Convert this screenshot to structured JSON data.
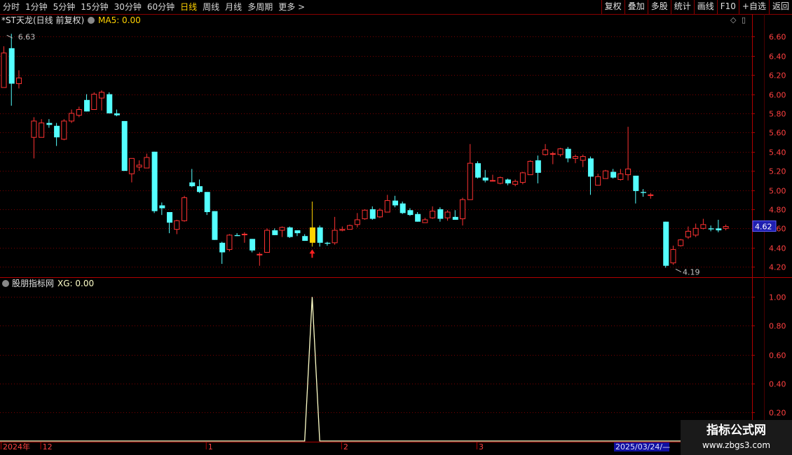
{
  "toolbar": {
    "periods": [
      {
        "label": "分时",
        "active": false
      },
      {
        "label": "1分钟",
        "active": false
      },
      {
        "label": "5分钟",
        "active": false
      },
      {
        "label": "15分钟",
        "active": false
      },
      {
        "label": "30分钟",
        "active": false
      },
      {
        "label": "60分钟",
        "active": false
      },
      {
        "label": "日线",
        "active": true
      },
      {
        "label": "周线",
        "active": false
      },
      {
        "label": "月线",
        "active": false
      },
      {
        "label": "多周期",
        "active": false
      },
      {
        "label": "更多 >",
        "active": false
      }
    ],
    "buttons": [
      "复权",
      "叠加",
      "多股",
      "统计",
      "画线",
      "F10",
      "+自选",
      "返回"
    ]
  },
  "chart_data": [
    {
      "type": "candlestick",
      "title": "*ST天龙(日线 前复权)",
      "indicator_label": "MA5: 0.00",
      "ylim": [
        4.12,
        6.72
      ],
      "y_ticks": [
        4.2,
        4.4,
        4.6,
        4.8,
        5.0,
        5.2,
        5.4,
        5.6,
        5.8,
        6.0,
        6.2,
        6.4,
        6.6
      ],
      "current_price": "4.62",
      "max_label": "6.63",
      "min_label": "4.19",
      "up_color": "#ff3232",
      "down_color": "#54ffff",
      "signal_color": "#ffd200",
      "x_labels": [
        {
          "text": "2024年",
          "index": 0
        },
        {
          "text": "12",
          "index": 5
        },
        {
          "text": "1",
          "index": 27
        },
        {
          "text": "2",
          "index": 45
        },
        {
          "text": "3",
          "index": 63
        }
      ],
      "date_label": "2025/03/24/—",
      "candles": [
        [
          6.07,
          6.43,
          6.5,
          6.07
        ],
        [
          6.48,
          6.11,
          6.63,
          5.88
        ],
        [
          6.11,
          6.17,
          6.25,
          6.06
        ],
        [
          null,
          null,
          null,
          null
        ],
        [
          5.55,
          5.72,
          5.76,
          5.33
        ],
        [
          5.55,
          5.7,
          5.74,
          5.55
        ],
        [
          5.7,
          5.68,
          5.74,
          5.65
        ],
        [
          5.67,
          5.55,
          5.7,
          5.46
        ],
        [
          5.53,
          5.72,
          5.74,
          5.52
        ],
        [
          5.72,
          5.8,
          5.84,
          5.7
        ],
        [
          5.78,
          5.84,
          5.87,
          5.76
        ],
        [
          5.94,
          5.82,
          6.0,
          5.82
        ],
        [
          5.84,
          6.0,
          6.02,
          5.85
        ],
        [
          5.96,
          6.02,
          6.04,
          5.83
        ],
        [
          6.0,
          5.8,
          6.02,
          5.8
        ],
        [
          5.8,
          5.78,
          5.84,
          5.77
        ],
        [
          5.72,
          5.2,
          5.72,
          5.2
        ],
        [
          5.17,
          5.33,
          5.33,
          5.08
        ],
        [
          5.24,
          5.26,
          5.31,
          5.2
        ],
        [
          5.23,
          5.34,
          5.38,
          5.23
        ],
        [
          5.4,
          4.78,
          5.4,
          4.76
        ],
        [
          4.84,
          4.81,
          4.87,
          4.74
        ],
        [
          4.77,
          4.66,
          4.77,
          4.55
        ],
        [
          4.59,
          4.68,
          4.69,
          4.54
        ],
        [
          4.68,
          4.92,
          4.94,
          4.67
        ],
        [
          5.08,
          5.04,
          5.22,
          5.03
        ],
        [
          5.04,
          4.98,
          5.11,
          4.97
        ],
        [
          4.98,
          4.77,
          4.98,
          4.74
        ],
        [
          4.78,
          4.48,
          4.78,
          4.48
        ],
        [
          4.45,
          4.35,
          4.46,
          4.23
        ],
        [
          4.38,
          4.53,
          4.54,
          4.36
        ],
        [
          4.53,
          4.52,
          4.55,
          4.52
        ],
        [
          4.54,
          4.54,
          4.56,
          4.45
        ],
        [
          4.49,
          4.37,
          4.49,
          4.35
        ],
        [
          4.33,
          4.33,
          4.35,
          4.21
        ],
        [
          4.35,
          4.58,
          4.6,
          4.35
        ],
        [
          4.58,
          4.53,
          4.6,
          4.53
        ],
        [
          4.58,
          4.61,
          4.62,
          4.51
        ],
        [
          4.61,
          4.51,
          4.62,
          4.5
        ],
        [
          4.58,
          4.55,
          4.58,
          4.52
        ],
        [
          4.52,
          4.47,
          4.54,
          4.47
        ],
        [
          4.45,
          4.61,
          4.88,
          4.41
        ],
        [
          4.61,
          4.45,
          4.63,
          4.41
        ],
        [
          4.45,
          4.44,
          4.46,
          4.42
        ],
        [
          4.45,
          4.58,
          4.72,
          4.43
        ],
        [
          4.58,
          4.59,
          4.62,
          4.57
        ],
        [
          4.59,
          4.63,
          4.64,
          4.59
        ],
        [
          4.64,
          4.69,
          4.76,
          4.61
        ],
        [
          4.7,
          4.79,
          4.8,
          4.69
        ],
        [
          4.8,
          4.7,
          4.83,
          4.69
        ],
        [
          4.72,
          4.79,
          4.81,
          4.71
        ],
        [
          4.77,
          4.89,
          4.95,
          4.77
        ],
        [
          4.89,
          4.84,
          4.94,
          4.82
        ],
        [
          4.86,
          4.76,
          4.88,
          4.75
        ],
        [
          4.79,
          4.74,
          4.81,
          4.73
        ],
        [
          4.75,
          4.67,
          4.77,
          4.67
        ],
        [
          4.66,
          4.69,
          4.71,
          4.66
        ],
        [
          4.71,
          4.78,
          4.83,
          4.7
        ],
        [
          4.8,
          4.7,
          4.82,
          4.67
        ],
        [
          4.71,
          4.77,
          4.79,
          4.68
        ],
        [
          4.72,
          4.69,
          4.79,
          4.69
        ],
        [
          4.7,
          4.9,
          4.92,
          4.63
        ],
        [
          4.9,
          5.28,
          5.48,
          4.9
        ],
        [
          5.28,
          5.13,
          5.3,
          5.12
        ],
        [
          5.13,
          5.1,
          5.21,
          5.08
        ],
        [
          5.1,
          5.1,
          5.16,
          5.09
        ],
        [
          5.07,
          5.13,
          5.14,
          5.06
        ],
        [
          5.11,
          5.07,
          5.12,
          5.05
        ],
        [
          5.06,
          5.09,
          5.11,
          5.04
        ],
        [
          5.08,
          5.18,
          5.19,
          5.06
        ],
        [
          5.16,
          5.3,
          5.31,
          5.16
        ],
        [
          5.31,
          5.18,
          5.36,
          5.07
        ],
        [
          5.37,
          5.42,
          5.48,
          5.36
        ],
        [
          5.38,
          5.38,
          5.4,
          5.27
        ],
        [
          5.37,
          5.43,
          5.44,
          5.35
        ],
        [
          5.43,
          5.33,
          5.45,
          5.29
        ],
        [
          5.33,
          5.35,
          5.37,
          5.28
        ],
        [
          5.31,
          5.35,
          5.37,
          5.24
        ],
        [
          5.33,
          5.14,
          5.35,
          4.95
        ],
        [
          5.05,
          5.14,
          5.17,
          5.05
        ],
        [
          5.12,
          5.2,
          5.21,
          5.12
        ],
        [
          5.19,
          5.13,
          5.22,
          5.12
        ],
        [
          5.11,
          5.17,
          5.22,
          5.1
        ],
        [
          5.16,
          5.22,
          5.66,
          5.1
        ],
        [
          5.15,
          4.99,
          5.15,
          4.86
        ],
        [
          4.98,
          4.97,
          5.01,
          4.93
        ],
        [
          4.95,
          4.95,
          4.97,
          4.91
        ],
        [
          null,
          null,
          null,
          null
        ],
        [
          4.67,
          4.21,
          4.67,
          4.19
        ],
        [
          4.24,
          4.38,
          4.42,
          4.22
        ],
        [
          4.42,
          4.48,
          4.49,
          4.41
        ],
        [
          4.51,
          4.57,
          4.62,
          4.49
        ],
        [
          4.53,
          4.6,
          4.65,
          4.51
        ],
        [
          4.6,
          4.64,
          4.7,
          4.59
        ],
        [
          4.6,
          4.59,
          4.63,
          4.57
        ],
        [
          4.6,
          4.58,
          4.69,
          4.56
        ],
        [
          4.6,
          4.62,
          4.64,
          4.58
        ]
      ],
      "signal_index": 41
    },
    {
      "type": "line",
      "title": "股朋指标网",
      "indicator_label": "XG: 0.00",
      "ylim": [
        0,
        1.05
      ],
      "y_ticks": [
        0.2,
        0.4,
        0.6,
        0.8,
        1.0
      ],
      "series": [
        {
          "name": "XG",
          "color": "#ffffc8",
          "spike_index": 41,
          "spike_value": 1.0,
          "base_value": 0.0
        }
      ]
    }
  ],
  "watermark": {
    "line1": "指标公式网",
    "line2": "www.zbgs3.com"
  }
}
